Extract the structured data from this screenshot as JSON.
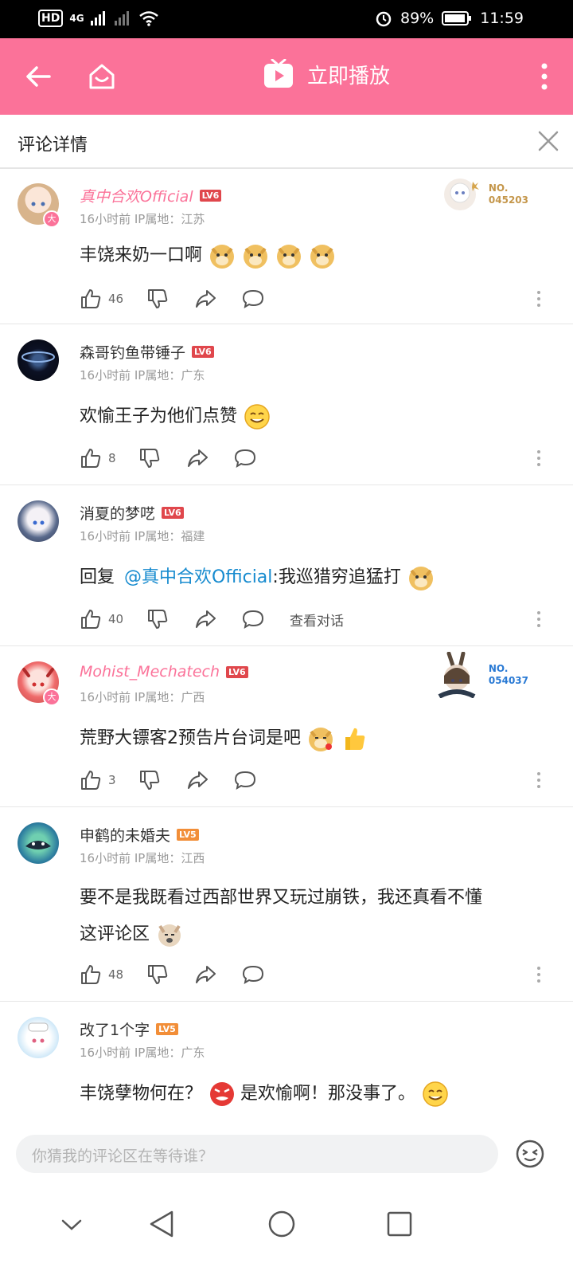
{
  "status_bar": {
    "left_badges": [
      "HD",
      "4G"
    ],
    "battery": "89%",
    "time": "11:59"
  },
  "top_bar": {
    "play_label": "立即播放",
    "accent": "#fb7299"
  },
  "sub_header": {
    "title": "评论详情"
  },
  "comments": [
    {
      "username": "真中合欢Official",
      "level": "LV6",
      "meta": "16小时前  IP属地：江苏",
      "text": "丰饶来奶一口啊",
      "likes": "46",
      "fan_no": "NO.",
      "fan_id": "045203",
      "vip": true
    },
    {
      "username": "森哥钓鱼带锤子",
      "level": "LV6",
      "meta": "16小时前  IP属地：广东",
      "text": "欢愉王子为他们点赞",
      "likes": "8"
    },
    {
      "username": "消夏的梦呓",
      "level": "LV6",
      "meta": "16小时前  IP属地：福建",
      "reply_prefix": "回复",
      "mention": "@真中合欢Official",
      "text": ":我巡猎穷追猛打",
      "likes": "40",
      "view_conversation": "查看对话"
    },
    {
      "username": "Mohist_Mechatech",
      "level": "LV6",
      "meta": "16小时前  IP属地：广西",
      "text": "荒野大镖客2预告片台词是吧",
      "likes": "3",
      "fan_no": "NO.",
      "fan_id": "054037",
      "vip": true
    },
    {
      "username": "申鹤的未婚夫",
      "level": "LV5",
      "meta": "16小时前  IP属地：江西",
      "text_line1": "要不是我既看过西部世界又玩过崩铁，我还真看不懂",
      "text_line2": "这评论区",
      "likes": "48"
    },
    {
      "username": "改了1个字",
      "level": "LV5",
      "meta": "16小时前  IP属地：广东",
      "text_a": "丰饶孽物何在？",
      "text_b": "是欢愉啊！那没事了。"
    }
  ],
  "input": {
    "placeholder": "你猜我的评论区在等待谁？"
  },
  "colors": {
    "lv6": "#e0474c",
    "lv5": "#f28e38",
    "mention": "#178bcf",
    "fan_gold": "#c4964a",
    "fan_blue": "#2a7ad4"
  }
}
